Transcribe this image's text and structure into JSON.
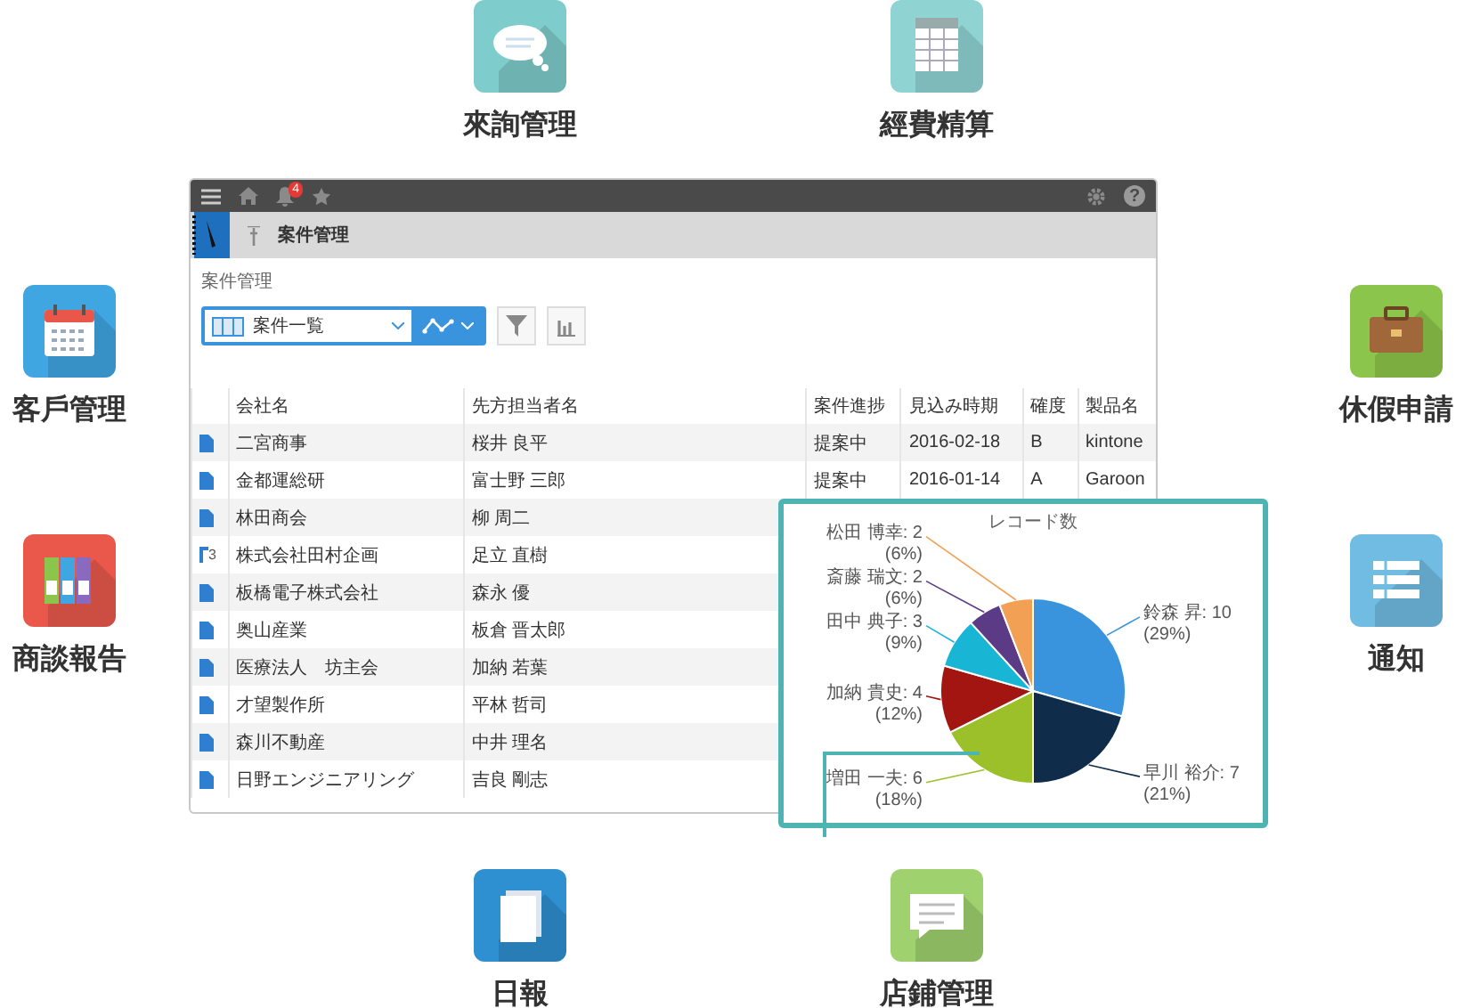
{
  "features": [
    {
      "label": "來詢管理",
      "kind": "chat",
      "color": "#7ecccb"
    },
    {
      "label": "經費精算",
      "kind": "sheet",
      "color": "#8fd4d3"
    },
    {
      "label": "客戶管理",
      "kind": "calendar",
      "color": "#3fa6e2"
    },
    {
      "label": "休假申請",
      "kind": "briefcase",
      "color": "#8cc54b"
    },
    {
      "label": "商談報告",
      "kind": "binders",
      "color": "#e9584b"
    },
    {
      "label": "通知",
      "kind": "list",
      "color": "#70bce2"
    },
    {
      "label": "日報",
      "kind": "document",
      "color": "#2e8fd1"
    },
    {
      "label": "店鋪管理",
      "kind": "message",
      "color": "#9fd16e"
    }
  ],
  "window": {
    "notification_badge": "4",
    "help": "?",
    "app_title": "案件管理",
    "breadcrumb": "案件管理",
    "view_name": "案件一覧",
    "table": {
      "columns": [
        "会社名",
        "先方担当者名",
        "案件進捗",
        "見込み時期",
        "確度",
        "製品名"
      ],
      "rows": [
        {
          "kind": "record",
          "cells": [
            "二宮商事",
            "桜井 良平",
            "提案中",
            "2016-02-18",
            "B",
            "kintone"
          ]
        },
        {
          "kind": "record",
          "cells": [
            "金都運総研",
            "富士野 三郎",
            "提案中",
            "2016-01-14",
            "A",
            "Garoon"
          ]
        },
        {
          "kind": "record",
          "cells": [
            "林田商会",
            "柳 周二"
          ]
        },
        {
          "kind": "thread",
          "badge": "3",
          "cells": [
            "株式会社田村企画",
            "足立 直樹"
          ]
        },
        {
          "kind": "record",
          "cells": [
            "板橋電子株式会社",
            "森永 優"
          ]
        },
        {
          "kind": "record",
          "cells": [
            "奥山産業",
            "板倉 晋太郎"
          ]
        },
        {
          "kind": "record",
          "cells": [
            "医療法人　坊主会",
            "加納 若葉"
          ]
        },
        {
          "kind": "record",
          "cells": [
            "才望製作所",
            "平林 哲司"
          ]
        },
        {
          "kind": "record",
          "cells": [
            "森川不動産",
            "中井 理名"
          ]
        },
        {
          "kind": "record",
          "cells": [
            "日野エンジニアリング",
            "吉良 剛志"
          ]
        }
      ]
    }
  },
  "chart_popup": {
    "chart_data": {
      "type": "pie",
      "title": "レコード数",
      "values": [
        10,
        7,
        6,
        4,
        3,
        2,
        2
      ],
      "value_labels": [
        "鈴森 昇: 10 (29%)",
        "早川 裕介: 7 (21%)",
        "増田 一夫: 6 (18%)",
        "加納 貴史: 4 (12%)",
        "田中 典子: 3 (9%)",
        "斎藤 瑞文: 2 (6%)",
        "松田 博幸: 2 (6%)"
      ],
      "colors": [
        "#3a94dd",
        "#0f2d4a",
        "#9bc02a",
        "#a31510",
        "#19b5d5",
        "#5b3a86",
        "#f2a154"
      ]
    }
  }
}
